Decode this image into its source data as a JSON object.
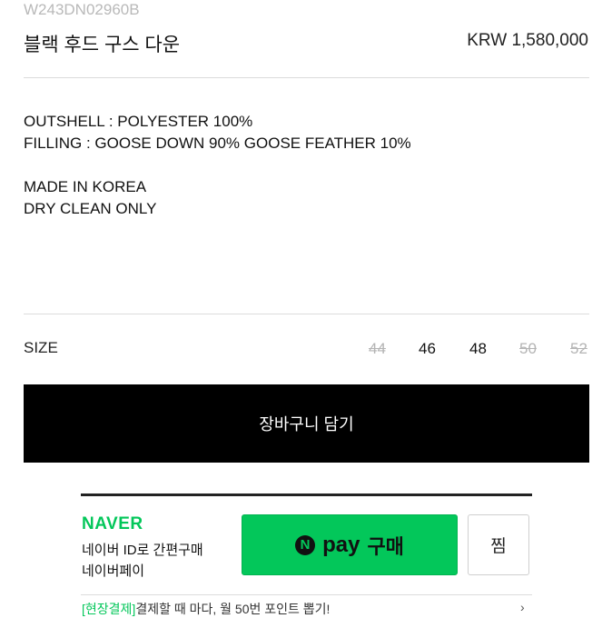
{
  "product": {
    "code": "W243DN02960B",
    "name": "블랙 후드 구스 다운",
    "price": "KRW 1,580,000"
  },
  "description": {
    "lines": [
      "OUTSHELL : POLYESTER 100%",
      "FILLING : GOOSE DOWN 90% GOOSE FEATHER 10%",
      "",
      "MADE IN KOREA",
      "DRY CLEAN ONLY"
    ]
  },
  "size": {
    "label": "SIZE",
    "options": [
      {
        "value": "44",
        "sold_out": true
      },
      {
        "value": "46",
        "sold_out": false
      },
      {
        "value": "48",
        "sold_out": false
      },
      {
        "value": "50",
        "sold_out": true
      },
      {
        "value": "52",
        "sold_out": true
      }
    ]
  },
  "cart": {
    "label": "장바구니 담기"
  },
  "naver": {
    "logo": "NAVER",
    "desc_line1": "네이버 ID로 간편구매",
    "desc_line2": "네이버페이",
    "pay_n": "N",
    "pay_word": "pay",
    "pay_buy": "구매",
    "zzim": "찜",
    "promo_tag": "[현장결제]",
    "promo_text": "결제할 때 마다, 월 50번 포인트 뽑기!",
    "promo_chevron": "›",
    "color": "#03c75a"
  }
}
